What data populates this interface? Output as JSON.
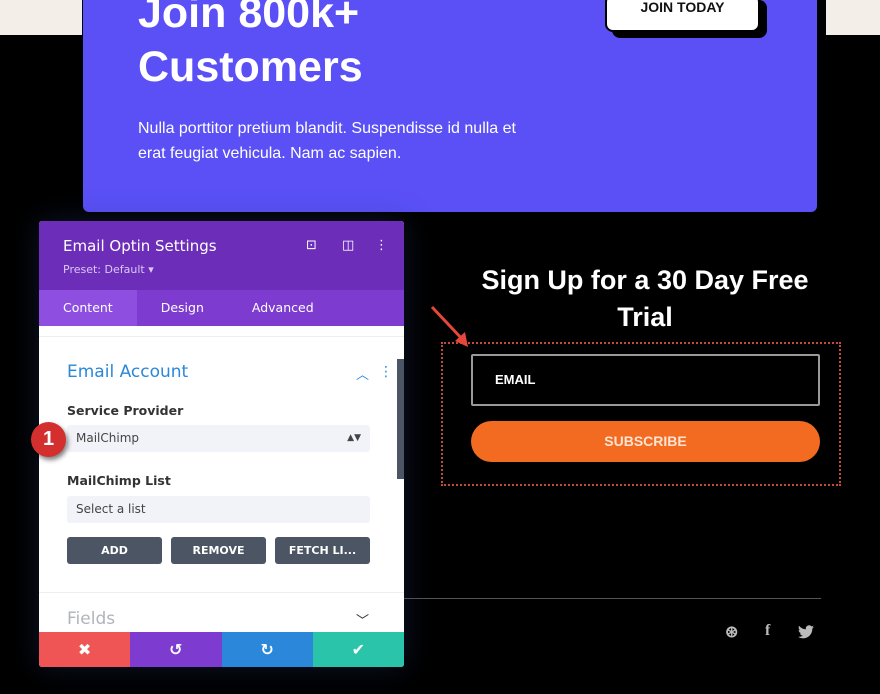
{
  "hero": {
    "title": "Join 800k+ Customers",
    "text": "Nulla porttitor pretium blandit. Suspendisse id nulla et erat feugiat vehicula. Nam ac sapien.",
    "cta": "JOIN TODAY"
  },
  "panel": {
    "title": "Email Optin Settings",
    "preset": "Preset: Default ▾",
    "tabs": [
      "Content",
      "Design",
      "Advanced"
    ],
    "section": "Email Account",
    "service_label": "Service Provider",
    "service_value": "MailChimp",
    "list_label": "MailChimp List",
    "list_value": "Select a list",
    "buttons": [
      "ADD",
      "REMOVE",
      "FETCH LI..."
    ],
    "fields_section": "Fields"
  },
  "signup": {
    "heading": "Sign Up for a 30 Day Free Trial",
    "email_placeholder": "EMAIL",
    "subscribe": "SUBSCRIBE"
  },
  "annotation": {
    "step": "1"
  },
  "colors": {
    "hero": "#5a50f6",
    "panel_header": "#6c2eb9",
    "subscribe": "#f26b21",
    "cancel": "#ef5555",
    "undo": "#7e3bd0",
    "redo": "#2b87da",
    "save": "#29c4a9"
  }
}
